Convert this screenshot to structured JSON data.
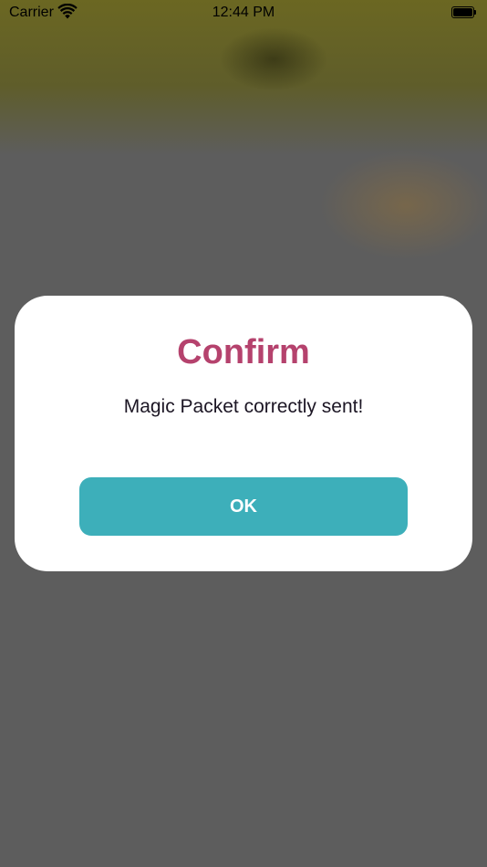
{
  "status_bar": {
    "carrier": "Carrier",
    "time": "12:44 PM",
    "wifi_icon": "wifi-icon",
    "battery_icon": "battery-icon"
  },
  "dialog": {
    "title": "Confirm",
    "message": "Magic Packet correctly sent!",
    "ok_label": "OK"
  },
  "colors": {
    "title": "#b5426d",
    "button": "#3dafba",
    "overlay": "#5d5d5d"
  }
}
